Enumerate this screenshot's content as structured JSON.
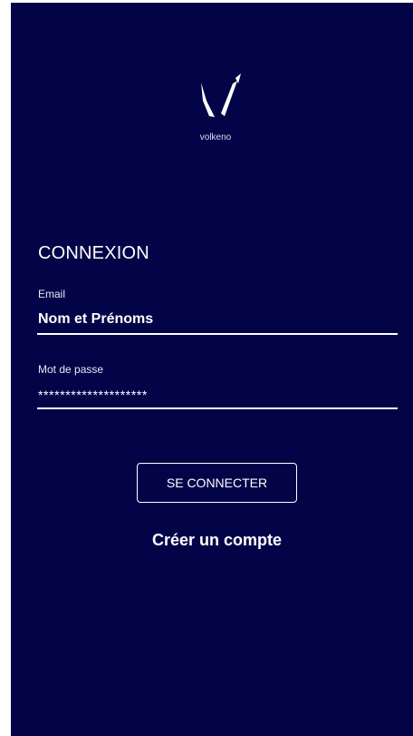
{
  "brand": {
    "logo_icon": "volkeno-v-icon",
    "name": "volkeno"
  },
  "login": {
    "title": "CONNEXION",
    "email_label": "Email",
    "email_value": "Nom et Prénoms",
    "password_label": "Mot de passe",
    "password_value": "********************",
    "submit_label": "SE CONNECTER",
    "signup_link": "Créer un compte"
  },
  "colors": {
    "background": "#030448",
    "text": "#ffffff"
  }
}
